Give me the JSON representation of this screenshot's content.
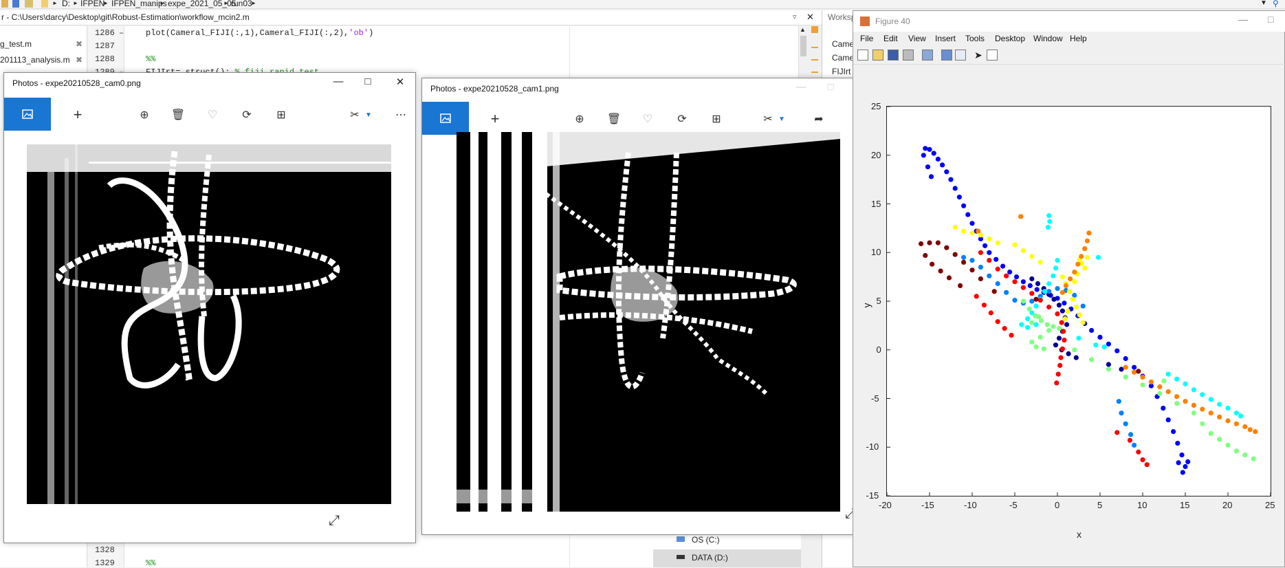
{
  "breadcrumb": [
    "D:",
    "IFPEN",
    "IFPEN_manips",
    "expe_2021_05_05",
    "run03"
  ],
  "editor": {
    "path": "r - C:\\Users\\darcy\\Desktop\\git\\Robust-Estimation\\workflow_mcin2.m",
    "files": [
      "g_test.m",
      "201113_analysis.m"
    ],
    "lines": [
      {
        "no": "1286",
        "marker": "–",
        "code": "plot(Cameral_FIJI(:,1),Cameral_FIJI(:,2),",
        "str": "'ob'",
        "tail": ")"
      },
      {
        "no": "1287",
        "marker": "",
        "code": "",
        "str": "",
        "tail": ""
      },
      {
        "no": "1288",
        "marker": "",
        "code": "",
        "str": "",
        "tail": ""
      },
      {
        "no": "1289",
        "marker": "–",
        "code": "FIJIrt= struct(); ",
        "str": "",
        "tail": ""
      }
    ],
    "line1288_comment": "%%",
    "line1289_comment": "% fiji rapid test",
    "bottom_lines": [
      {
        "no": "1328"
      },
      {
        "no": "1329",
        "comment": "%%"
      }
    ]
  },
  "workspace": {
    "title": "Worksp",
    "vars": [
      "Came",
      "Came",
      "FIJIrt"
    ]
  },
  "current_folder": {
    "drives": [
      "OS (C:)",
      "DATA (D:)"
    ]
  },
  "photo_cam0": {
    "title": "Photos - expe20210528_cam0.png",
    "controls": {
      "minimize": "—",
      "maximize": "□",
      "close": "✕"
    }
  },
  "photo_cam1": {
    "title": "Photos - expe20210528_cam1.png"
  },
  "figure": {
    "title": "Figure 40",
    "menus": [
      "File",
      "Edit",
      "View",
      "Insert",
      "Tools",
      "Desktop",
      "Window",
      "Help"
    ]
  },
  "colors": {
    "photos_accent": "#1976d2",
    "jet": [
      "#00008f",
      "#0000ff",
      "#0080ff",
      "#00ffff",
      "#80ff80",
      "#ffff00",
      "#ff8000",
      "#ff0000",
      "#800000"
    ]
  },
  "chart_data": {
    "type": "scatter",
    "xlabel": "x",
    "ylabel": "y",
    "xlim": [
      -20,
      25
    ],
    "ylim": [
      -15,
      25
    ],
    "xticks": [
      -20,
      -15,
      -10,
      -5,
      0,
      5,
      10,
      15,
      20,
      25
    ],
    "yticks": [
      -15,
      -10,
      -5,
      0,
      5,
      10,
      15,
      20,
      25
    ],
    "grid": false,
    "colormap": "jet",
    "series": [
      {
        "color": "#0000ff",
        "points": [
          [
            -15.5,
            20.7
          ],
          [
            -15,
            20.6
          ],
          [
            -14.5,
            20.2
          ],
          [
            -14,
            19.6
          ],
          [
            -13.5,
            19
          ],
          [
            -13,
            18.3
          ],
          [
            -12.5,
            17.5
          ],
          [
            -12,
            16.6
          ],
          [
            -11.5,
            15.7
          ],
          [
            -11,
            14.8
          ],
          [
            -10.5,
            13.9
          ],
          [
            -10,
            13
          ],
          [
            -9.5,
            12.2
          ],
          [
            -9,
            11.4
          ],
          [
            -8.5,
            10.7
          ],
          [
            -8,
            10
          ],
          [
            -7.2,
            9.3
          ],
          [
            -6.4,
            8.6
          ],
          [
            -5.6,
            8
          ],
          [
            -4.8,
            7.5
          ],
          [
            -4,
            7
          ],
          [
            -3.2,
            6.6
          ],
          [
            -2.4,
            6.2
          ],
          [
            -1.6,
            5.9
          ],
          [
            -0.8,
            5.6
          ],
          [
            0,
            5.3
          ],
          [
            0.8,
            4.8
          ],
          [
            1.6,
            4.2
          ],
          [
            2.4,
            3.5
          ],
          [
            3.2,
            2.7
          ],
          [
            4,
            2
          ],
          [
            5,
            1.3
          ],
          [
            6,
            0.6
          ],
          [
            7,
            -0.1
          ],
          [
            8,
            -0.9
          ],
          [
            9,
            -1.8
          ],
          [
            10,
            -2.7
          ],
          [
            11,
            -3.7
          ],
          [
            11.7,
            -4.8
          ],
          [
            12.4,
            -6
          ],
          [
            13,
            -7.2
          ],
          [
            13.6,
            -8.4
          ],
          [
            14.1,
            -9.6
          ],
          [
            14.6,
            -10.8
          ],
          [
            15,
            -12
          ],
          [
            14.7,
            -12.6
          ],
          [
            14.2,
            -11.6
          ],
          [
            15.3,
            -11.5
          ],
          [
            -15.7,
            20
          ],
          [
            -15.2,
            18.8
          ],
          [
            -14.8,
            17.8
          ]
        ]
      },
      {
        "color": "#00008f",
        "points": [
          [
            -3,
            7.3
          ],
          [
            -2.3,
            6.8
          ],
          [
            -1.6,
            6.3
          ],
          [
            -1,
            5.7
          ],
          [
            -0.4,
            5.2
          ],
          [
            0.2,
            4.6
          ],
          [
            0.6,
            4
          ],
          [
            0.9,
            3.3
          ],
          [
            1.1,
            2.6
          ],
          [
            0.6,
            1.9
          ],
          [
            0.2,
            1.2
          ],
          [
            -0.2,
            0.5
          ],
          [
            0.5,
            0
          ],
          [
            1.3,
            -0.4
          ],
          [
            2.2,
            -0.8
          ],
          [
            6,
            -1.5
          ],
          [
            7.5,
            -2
          ]
        ]
      },
      {
        "color": "#0080ff",
        "points": [
          [
            -11,
            9.5
          ],
          [
            -10,
            9.2
          ],
          [
            -9,
            8.5
          ],
          [
            -8,
            7.6
          ],
          [
            -7,
            6.8
          ],
          [
            -6,
            5.9
          ],
          [
            -5,
            5.1
          ],
          [
            -4,
            4.8
          ],
          [
            -3,
            5
          ],
          [
            -2,
            5.5
          ],
          [
            -1,
            6
          ],
          [
            0,
            6.3
          ],
          [
            1,
            6.1
          ],
          [
            2,
            5.6
          ],
          [
            3,
            4.5
          ],
          [
            7.2,
            -5.3
          ],
          [
            7.5,
            -6.5
          ],
          [
            8,
            -7.6
          ],
          [
            8.6,
            -8.7
          ],
          [
            9,
            -9.8
          ]
        ]
      },
      {
        "color": "#00ffff",
        "points": [
          [
            -1,
            13.8
          ],
          [
            -0.9,
            13.2
          ],
          [
            -1.1,
            12.6
          ],
          [
            0,
            9.2
          ],
          [
            -0.2,
            8.4
          ],
          [
            -0.5,
            7.6
          ],
          [
            -1,
            6.8
          ],
          [
            -1.5,
            6
          ],
          [
            -2,
            5.2
          ],
          [
            -2.5,
            4.5
          ],
          [
            -3,
            3.8
          ],
          [
            -3.5,
            3.2
          ],
          [
            -4.2,
            2.6
          ],
          [
            -3.5,
            2.3
          ],
          [
            -2.5,
            2.6
          ],
          [
            2.5,
            1.2
          ],
          [
            4.5,
            0.5
          ],
          [
            5.5,
            0.3
          ],
          [
            13,
            -2.5
          ],
          [
            14,
            -3
          ],
          [
            15,
            -3.5
          ],
          [
            16,
            -4.1
          ],
          [
            17,
            -4.6
          ],
          [
            18,
            -5.1
          ],
          [
            19,
            -5.6
          ],
          [
            20,
            -6
          ],
          [
            21,
            -6.5
          ],
          [
            21.5,
            -6.8
          ],
          [
            4.8,
            9.5
          ]
        ]
      },
      {
        "color": "#80ff80",
        "points": [
          [
            -4,
            5
          ],
          [
            -3.3,
            4.2
          ],
          [
            -2.6,
            3.5
          ],
          [
            -1.9,
            3
          ],
          [
            -1.2,
            2.6
          ],
          [
            -0.5,
            2.4
          ],
          [
            0.2,
            2.2
          ],
          [
            -3,
            2.8
          ],
          [
            -2.2,
            3.4
          ],
          [
            -1,
            2
          ],
          [
            -2,
            1.3
          ],
          [
            -3,
            0.8
          ],
          [
            -2.5,
            0.3
          ],
          [
            -1.6,
            0.1
          ],
          [
            2,
            0
          ],
          [
            4,
            -1
          ],
          [
            6,
            -2
          ],
          [
            8,
            -2.8
          ],
          [
            10,
            -3.6
          ],
          [
            12,
            -4.5
          ],
          [
            14,
            -5.5
          ],
          [
            16,
            -6.5
          ],
          [
            17,
            -7.6
          ],
          [
            18,
            -8.6
          ],
          [
            19,
            -9.2
          ],
          [
            20,
            -9.8
          ],
          [
            21,
            -10.4
          ],
          [
            22,
            -10.8
          ],
          [
            23,
            -11.2
          ],
          [
            12.5,
            -3.2
          ]
        ]
      },
      {
        "color": "#ffff00",
        "points": [
          [
            -12,
            12.6
          ],
          [
            -11,
            12.2
          ],
          [
            -10,
            12
          ],
          [
            -9,
            11.8
          ],
          [
            -8,
            11.4
          ],
          [
            -7,
            11
          ],
          [
            -5,
            10.8
          ],
          [
            -4,
            10.2
          ],
          [
            -3,
            9.6
          ],
          [
            -2,
            9
          ],
          [
            0.6,
            7.5
          ],
          [
            1,
            6.8
          ],
          [
            1.4,
            6
          ],
          [
            1.8,
            5.2
          ],
          [
            2.2,
            4.4
          ],
          [
            2.6,
            3.6
          ],
          [
            3,
            2.8
          ],
          [
            3.2,
            8.4
          ],
          [
            2.8,
            8.9
          ],
          [
            2.6,
            9.3
          ],
          [
            2.3,
            7.8
          ],
          [
            2,
            7
          ],
          [
            3.5,
            9.5
          ],
          [
            1.2,
            4
          ],
          [
            0.9,
            3.2
          ]
        ]
      },
      {
        "color": "#ff8000",
        "points": [
          [
            -4.3,
            13.7
          ],
          [
            3.7,
            12
          ],
          [
            3.5,
            11.2
          ],
          [
            3.2,
            10.4
          ],
          [
            2.8,
            9.6
          ],
          [
            2.4,
            8.8
          ],
          [
            2,
            8
          ],
          [
            1.5,
            7.3
          ],
          [
            1,
            6.6
          ],
          [
            0.6,
            5.9
          ],
          [
            8,
            -1.8
          ],
          [
            9,
            -2.3
          ],
          [
            10,
            -2.8
          ],
          [
            11,
            -3.3
          ],
          [
            12,
            -3.8
          ],
          [
            13,
            -4.3
          ],
          [
            14,
            -4.8
          ],
          [
            15,
            -5.3
          ],
          [
            16,
            -5.7
          ],
          [
            17,
            -6.1
          ],
          [
            18,
            -6.5
          ],
          [
            19,
            -6.9
          ],
          [
            20,
            -7.3
          ],
          [
            21,
            -7.6
          ],
          [
            22,
            -7.9
          ],
          [
            22.6,
            -8.2
          ],
          [
            23.2,
            -8.4
          ],
          [
            -9.3,
            12.2
          ]
        ]
      },
      {
        "color": "#ff0000",
        "points": [
          [
            -9,
            10
          ],
          [
            -8,
            9.2
          ],
          [
            -7,
            8.3
          ],
          [
            -6,
            7.6
          ],
          [
            -5,
            7
          ],
          [
            -4,
            6.4
          ],
          [
            -3,
            5.8
          ],
          [
            -2,
            5.1
          ],
          [
            -1,
            4.4
          ],
          [
            0,
            3.7
          ],
          [
            0.5,
            2.8
          ],
          [
            0.7,
            1.9
          ],
          [
            0.8,
            1
          ],
          [
            0.6,
            0.1
          ],
          [
            0.4,
            -0.8
          ],
          [
            0.3,
            -1.6
          ],
          [
            0.1,
            -2.5
          ],
          [
            -0.1,
            -3.4
          ],
          [
            -9.5,
            5.5
          ],
          [
            -8.6,
            4.6
          ],
          [
            -7.8,
            3.8
          ],
          [
            -7,
            2.9
          ],
          [
            -6.2,
            2.2
          ],
          [
            -5.4,
            1.5
          ],
          [
            7,
            -8.5
          ],
          [
            8.5,
            -9.3
          ],
          [
            9.5,
            -10.5
          ],
          [
            10,
            -11.3
          ],
          [
            10.5,
            -11.8
          ]
        ]
      },
      {
        "color": "#800000",
        "points": [
          [
            -16,
            10.9
          ],
          [
            -15,
            11
          ],
          [
            -14,
            11
          ],
          [
            -13,
            10.5
          ],
          [
            -12,
            9.8
          ],
          [
            -11,
            9
          ],
          [
            -10,
            8.2
          ],
          [
            -9,
            7.3
          ],
          [
            -15.5,
            9.7
          ],
          [
            -14.7,
            8.8
          ],
          [
            -13.7,
            8.1
          ],
          [
            -12.7,
            7.4
          ],
          [
            -11.4,
            6.6
          ],
          [
            -7.4,
            6
          ],
          [
            9.5,
            -2.2
          ],
          [
            -2.5,
            5.2
          ]
        ]
      }
    ]
  }
}
